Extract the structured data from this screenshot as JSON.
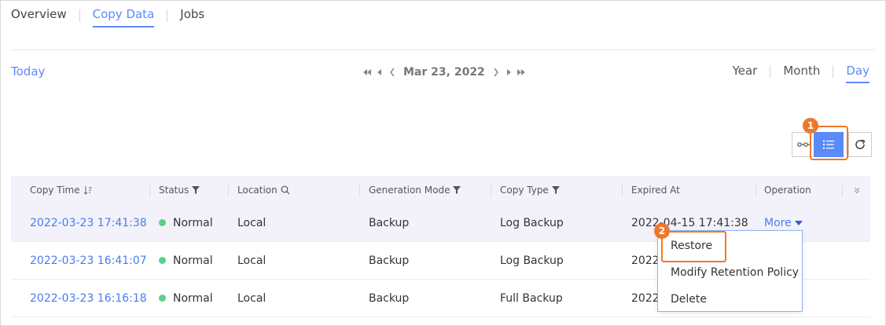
{
  "tabs": [
    {
      "label": "Overview",
      "active": false
    },
    {
      "label": "Copy Data",
      "active": true
    },
    {
      "label": "Jobs",
      "active": false
    }
  ],
  "date_nav": {
    "today_label": "Today",
    "current_date": "Mar 23, 2022"
  },
  "granularity": [
    {
      "label": "Year",
      "active": false
    },
    {
      "label": "Month",
      "active": false
    },
    {
      "label": "Day",
      "active": true
    }
  ],
  "view_toggle": {
    "active": "list"
  },
  "callouts": [
    "1",
    "2"
  ],
  "table": {
    "columns": [
      "Copy Time",
      "Status",
      "Location",
      "Generation Mode",
      "Copy Type",
      "Expired At",
      "Operation"
    ],
    "rows": [
      {
        "copy_time": "2022-03-23 17:41:38",
        "status": "Normal",
        "location": "Local",
        "generation_mode": "Backup",
        "copy_type": "Log Backup",
        "expired_at": "2022-04-15 17:41:38",
        "operation": "More"
      },
      {
        "copy_time": "2022-03-23 16:41:07",
        "status": "Normal",
        "location": "Local",
        "generation_mode": "Backup",
        "copy_type": "Log Backup",
        "expired_at": "2022-",
        "operation": ""
      },
      {
        "copy_time": "2022-03-23 16:16:18",
        "status": "Normal",
        "location": "Local",
        "generation_mode": "Backup",
        "copy_type": "Full Backup",
        "expired_at": "2022-",
        "operation": ""
      }
    ]
  },
  "more_menu": {
    "items": [
      "Restore",
      "Modify Retention Policy",
      "Delete"
    ]
  },
  "colors": {
    "accent": "#5b8bf7",
    "callout": "#f0772a",
    "status_normal": "#5ccf8a"
  }
}
